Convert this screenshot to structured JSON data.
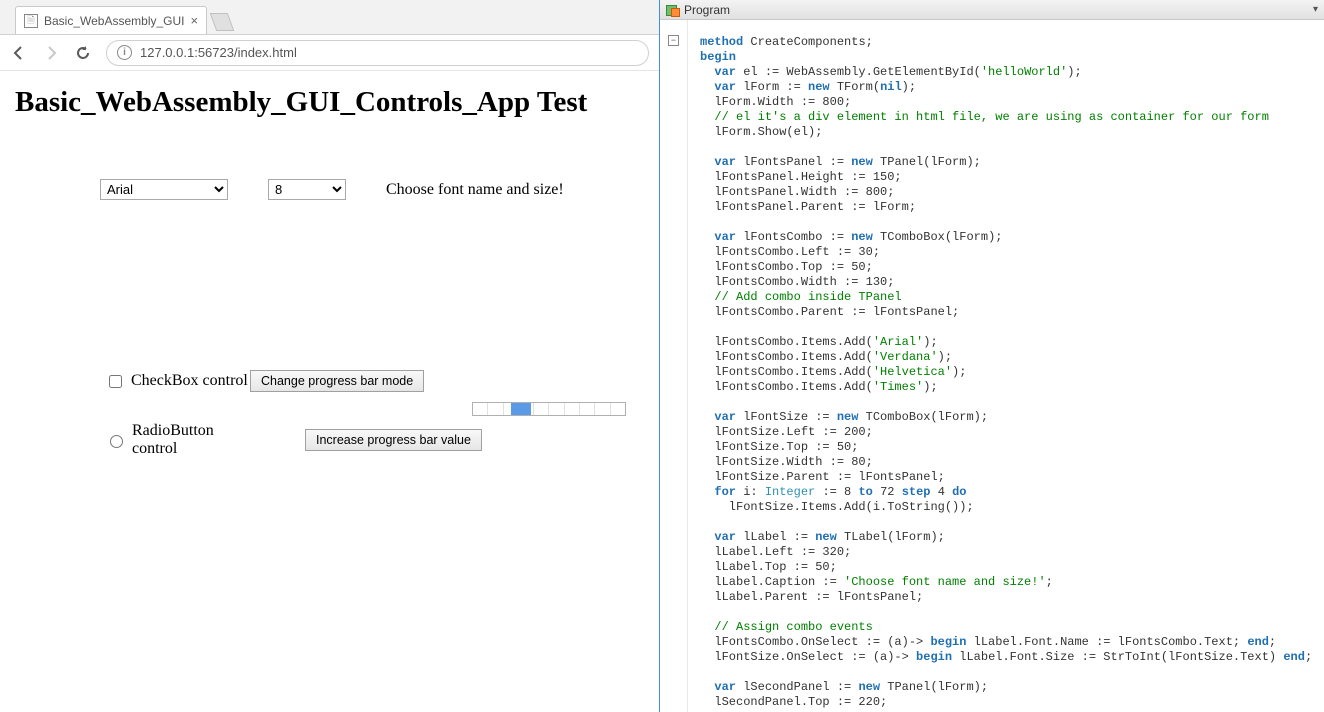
{
  "browser": {
    "tab_title": "Basic_WebAssembly_GUI",
    "url": "127.0.0.1:56723/index.html",
    "page_heading": "Basic_WebAssembly_GUI_Controls_App Test",
    "font_combo_value": "Arial",
    "size_combo_value": "8",
    "choose_label": "Choose font name and size!",
    "checkbox_label": "CheckBox control",
    "radio_label": "RadioButton control",
    "btn_change_mode": "Change progress bar mode",
    "btn_increase": "Increase progress bar value"
  },
  "ide": {
    "title": "Program",
    "fold_marker": "−",
    "code_lines": [
      {
        "i": 0,
        "segs": [
          {
            "c": "kw",
            "t": "method"
          },
          {
            "t": " CreateComponents;"
          }
        ]
      },
      {
        "i": 0,
        "segs": [
          {
            "c": "kw",
            "t": "begin"
          }
        ]
      },
      {
        "i": 1,
        "segs": [
          {
            "c": "kw",
            "t": "var"
          },
          {
            "t": " el := WebAssembly.GetElementById("
          },
          {
            "c": "s",
            "t": "'helloWorld'"
          },
          {
            "t": ");"
          }
        ]
      },
      {
        "i": 1,
        "segs": [
          {
            "c": "kw",
            "t": "var"
          },
          {
            "t": " lForm := "
          },
          {
            "c": "kw",
            "t": "new"
          },
          {
            "t": " TForm("
          },
          {
            "c": "kw",
            "t": "nil"
          },
          {
            "t": ");"
          }
        ]
      },
      {
        "i": 1,
        "segs": [
          {
            "t": "lForm.Width := 800;"
          }
        ]
      },
      {
        "i": 1,
        "segs": [
          {
            "c": "cm",
            "t": "// el it's a div element in html file, we are using as container for our form"
          }
        ]
      },
      {
        "i": 1,
        "segs": [
          {
            "t": "lForm.Show(el);"
          }
        ]
      },
      {
        "i": 0,
        "segs": [
          {
            "t": ""
          }
        ]
      },
      {
        "i": 1,
        "segs": [
          {
            "c": "kw",
            "t": "var"
          },
          {
            "t": " lFontsPanel := "
          },
          {
            "c": "kw",
            "t": "new"
          },
          {
            "t": " TPanel(lForm);"
          }
        ]
      },
      {
        "i": 1,
        "segs": [
          {
            "t": "lFontsPanel.Height := 150;"
          }
        ]
      },
      {
        "i": 1,
        "segs": [
          {
            "t": "lFontsPanel.Width := 800;"
          }
        ]
      },
      {
        "i": 1,
        "segs": [
          {
            "t": "lFontsPanel.Parent := lForm;"
          }
        ]
      },
      {
        "i": 0,
        "segs": [
          {
            "t": ""
          }
        ]
      },
      {
        "i": 1,
        "segs": [
          {
            "c": "kw",
            "t": "var"
          },
          {
            "t": " lFontsCombo := "
          },
          {
            "c": "kw",
            "t": "new"
          },
          {
            "t": " TComboBox(lForm);"
          }
        ]
      },
      {
        "i": 1,
        "segs": [
          {
            "t": "lFontsCombo.Left := 30;"
          }
        ]
      },
      {
        "i": 1,
        "segs": [
          {
            "t": "lFontsCombo.Top := 50;"
          }
        ]
      },
      {
        "i": 1,
        "segs": [
          {
            "t": "lFontsCombo.Width := 130;"
          }
        ]
      },
      {
        "i": 1,
        "segs": [
          {
            "c": "cm",
            "t": "// Add combo inside TPanel"
          }
        ]
      },
      {
        "i": 1,
        "segs": [
          {
            "t": "lFontsCombo.Parent := lFontsPanel;"
          }
        ]
      },
      {
        "i": 0,
        "segs": [
          {
            "t": ""
          }
        ]
      },
      {
        "i": 1,
        "segs": [
          {
            "t": "lFontsCombo.Items.Add("
          },
          {
            "c": "s",
            "t": "'Arial'"
          },
          {
            "t": ");"
          }
        ]
      },
      {
        "i": 1,
        "segs": [
          {
            "t": "lFontsCombo.Items.Add("
          },
          {
            "c": "s",
            "t": "'Verdana'"
          },
          {
            "t": ");"
          }
        ]
      },
      {
        "i": 1,
        "segs": [
          {
            "t": "lFontsCombo.Items.Add("
          },
          {
            "c": "s",
            "t": "'Helvetica'"
          },
          {
            "t": ");"
          }
        ]
      },
      {
        "i": 1,
        "segs": [
          {
            "t": "lFontsCombo.Items.Add("
          },
          {
            "c": "s",
            "t": "'Times'"
          },
          {
            "t": ");"
          }
        ]
      },
      {
        "i": 0,
        "segs": [
          {
            "t": ""
          }
        ]
      },
      {
        "i": 1,
        "segs": [
          {
            "c": "kw",
            "t": "var"
          },
          {
            "t": " lFontSize := "
          },
          {
            "c": "kw",
            "t": "new"
          },
          {
            "t": " TComboBox(lForm);"
          }
        ]
      },
      {
        "i": 1,
        "segs": [
          {
            "t": "lFontSize.Left := 200;"
          }
        ]
      },
      {
        "i": 1,
        "segs": [
          {
            "t": "lFontSize.Top := 50;"
          }
        ]
      },
      {
        "i": 1,
        "segs": [
          {
            "t": "lFontSize.Width := 80;"
          }
        ]
      },
      {
        "i": 1,
        "segs": [
          {
            "t": "lFontSize.Parent := lFontsPanel;"
          }
        ]
      },
      {
        "i": 1,
        "segs": [
          {
            "c": "kw",
            "t": "for"
          },
          {
            "t": " i: "
          },
          {
            "c": "ty",
            "t": "Integer"
          },
          {
            "t": " := 8 "
          },
          {
            "c": "kw",
            "t": "to"
          },
          {
            "t": " 72 "
          },
          {
            "c": "kw",
            "t": "step"
          },
          {
            "t": " 4 "
          },
          {
            "c": "kw",
            "t": "do"
          }
        ]
      },
      {
        "i": 2,
        "segs": [
          {
            "t": "lFontSize.Items.Add(i.ToString());"
          }
        ]
      },
      {
        "i": 0,
        "segs": [
          {
            "t": ""
          }
        ]
      },
      {
        "i": 1,
        "segs": [
          {
            "c": "kw",
            "t": "var"
          },
          {
            "t": " lLabel := "
          },
          {
            "c": "kw",
            "t": "new"
          },
          {
            "t": " TLabel(lForm);"
          }
        ]
      },
      {
        "i": 1,
        "segs": [
          {
            "t": "lLabel.Left := 320;"
          }
        ]
      },
      {
        "i": 1,
        "segs": [
          {
            "t": "lLabel.Top := 50;"
          }
        ]
      },
      {
        "i": 1,
        "segs": [
          {
            "t": "lLabel.Caption := "
          },
          {
            "c": "s",
            "t": "'Choose font name and size!'"
          },
          {
            "t": ";"
          }
        ]
      },
      {
        "i": 1,
        "segs": [
          {
            "t": "lLabel.Parent := lFontsPanel;"
          }
        ]
      },
      {
        "i": 0,
        "segs": [
          {
            "t": ""
          }
        ]
      },
      {
        "i": 1,
        "segs": [
          {
            "c": "cm",
            "t": "// Assign combo events"
          }
        ]
      },
      {
        "i": 1,
        "segs": [
          {
            "t": "lFontsCombo.OnSelect := (a)-> "
          },
          {
            "c": "kw",
            "t": "begin"
          },
          {
            "t": " lLabel.Font.Name := lFontsCombo.Text; "
          },
          {
            "c": "kw",
            "t": "end"
          },
          {
            "t": ";"
          }
        ]
      },
      {
        "i": 1,
        "hl": true,
        "segs": [
          {
            "t": "lFontSize.OnSelect := (a)-> "
          },
          {
            "c": "kw",
            "t": "begin"
          },
          {
            "t": " lLabel.Font.Size := StrToInt(lFontSize.Text) "
          },
          {
            "c": "kw",
            "t": "end"
          },
          {
            "t": ";"
          }
        ]
      },
      {
        "i": 0,
        "segs": [
          {
            "t": ""
          }
        ]
      },
      {
        "i": 1,
        "segs": [
          {
            "c": "kw",
            "t": "var"
          },
          {
            "t": " lSecondPanel := "
          },
          {
            "c": "kw",
            "t": "new"
          },
          {
            "t": " TPanel(lForm);"
          }
        ]
      },
      {
        "i": 1,
        "segs": [
          {
            "t": "lSecondPanel.Top := 220;"
          }
        ]
      }
    ]
  }
}
